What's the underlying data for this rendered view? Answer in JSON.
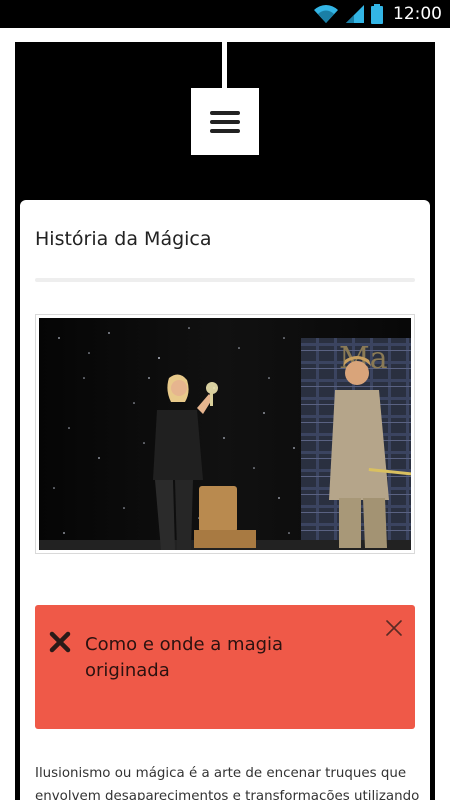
{
  "status_bar": {
    "time": "12:00",
    "icons": [
      "wifi-icon",
      "signal-icon",
      "battery-icon"
    ]
  },
  "menu": {
    "icon": "hamburger-menu-icon"
  },
  "card": {
    "title": "História da Mágica",
    "image_description_icon": "photo",
    "alert": {
      "icon": "x-icon",
      "text_line1": "Como e onde a magia",
      "text_line2": "originada",
      "close_icon": "close-icon"
    },
    "body_line1": "Ilusionismo ou mágica é a arte de encenar truques que",
    "body_line2": "envolvem desaparecimentos e transformações utilizando"
  },
  "colors": {
    "alert_bg": "#ef5948",
    "header_bg": "#000000",
    "status_bar_icons": "#33b5e5"
  }
}
